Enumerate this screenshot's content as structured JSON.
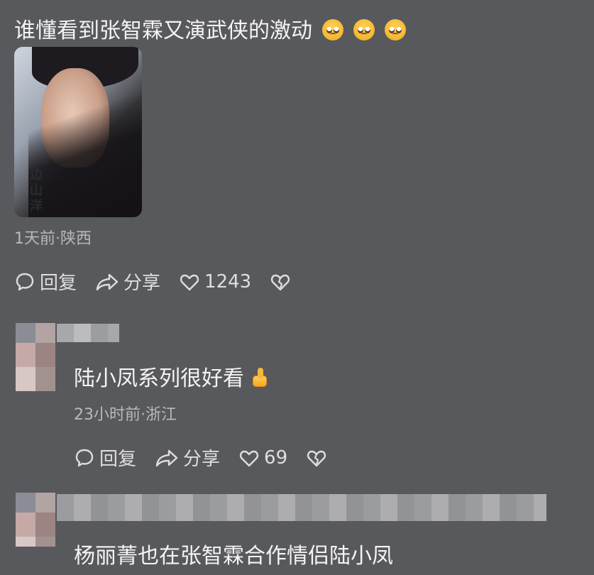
{
  "post": {
    "text": "谁懂看到张智霖又演武侠的激动",
    "emojis": [
      "pleading-face",
      "pleading-face",
      "pleading-face"
    ],
    "image_caption": "边山洋",
    "meta": "1天前·陕西",
    "actions": {
      "reply": "回复",
      "share": "分享",
      "likes": "1243"
    }
  },
  "replies": [
    {
      "text": "陆小凤系列很好看",
      "emoji": "thumbs-up",
      "meta": "23小时前·浙江",
      "actions": {
        "reply": "回复",
        "share": "分享",
        "likes": "69"
      }
    },
    {
      "text": "杨丽菁也在张智霖合作情侣陆小凤"
    }
  ]
}
